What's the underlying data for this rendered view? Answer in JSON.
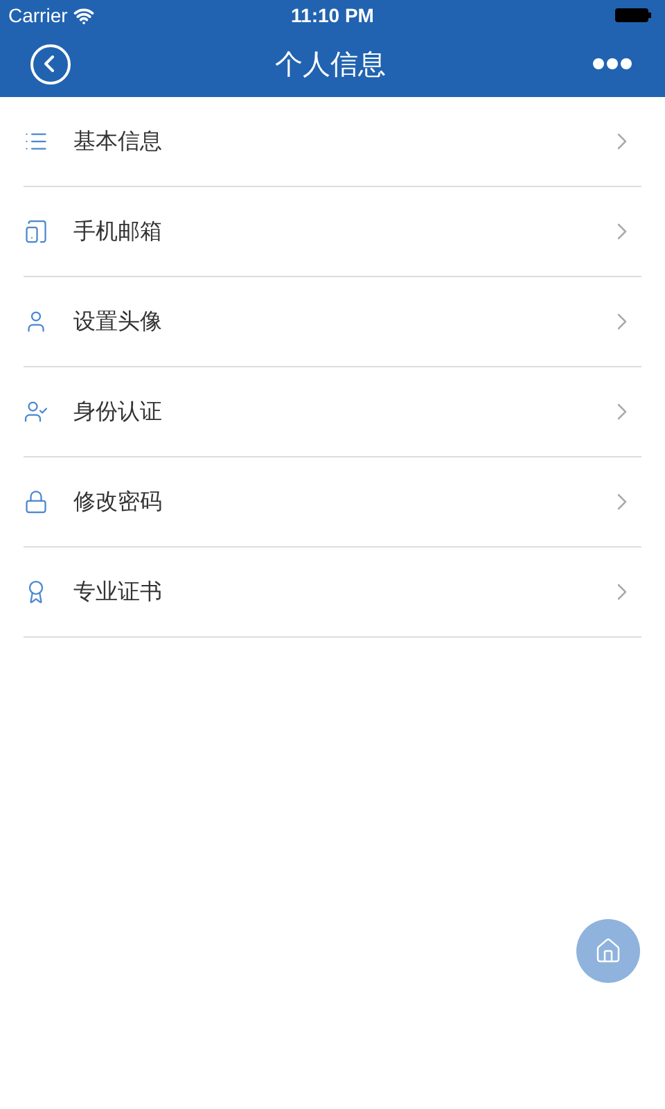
{
  "status_bar": {
    "carrier": "Carrier",
    "time": "11:10 PM"
  },
  "nav_bar": {
    "title": "个人信息"
  },
  "menu": [
    {
      "label": "基本信息",
      "kind": "info"
    },
    {
      "label": "手机邮箱",
      "kind": "phone"
    },
    {
      "label": "设置头像",
      "kind": "avatar"
    },
    {
      "label": "身份认证",
      "kind": "identity"
    },
    {
      "label": "修改密码",
      "kind": "password"
    },
    {
      "label": "专业证书",
      "kind": "certificate"
    }
  ]
}
